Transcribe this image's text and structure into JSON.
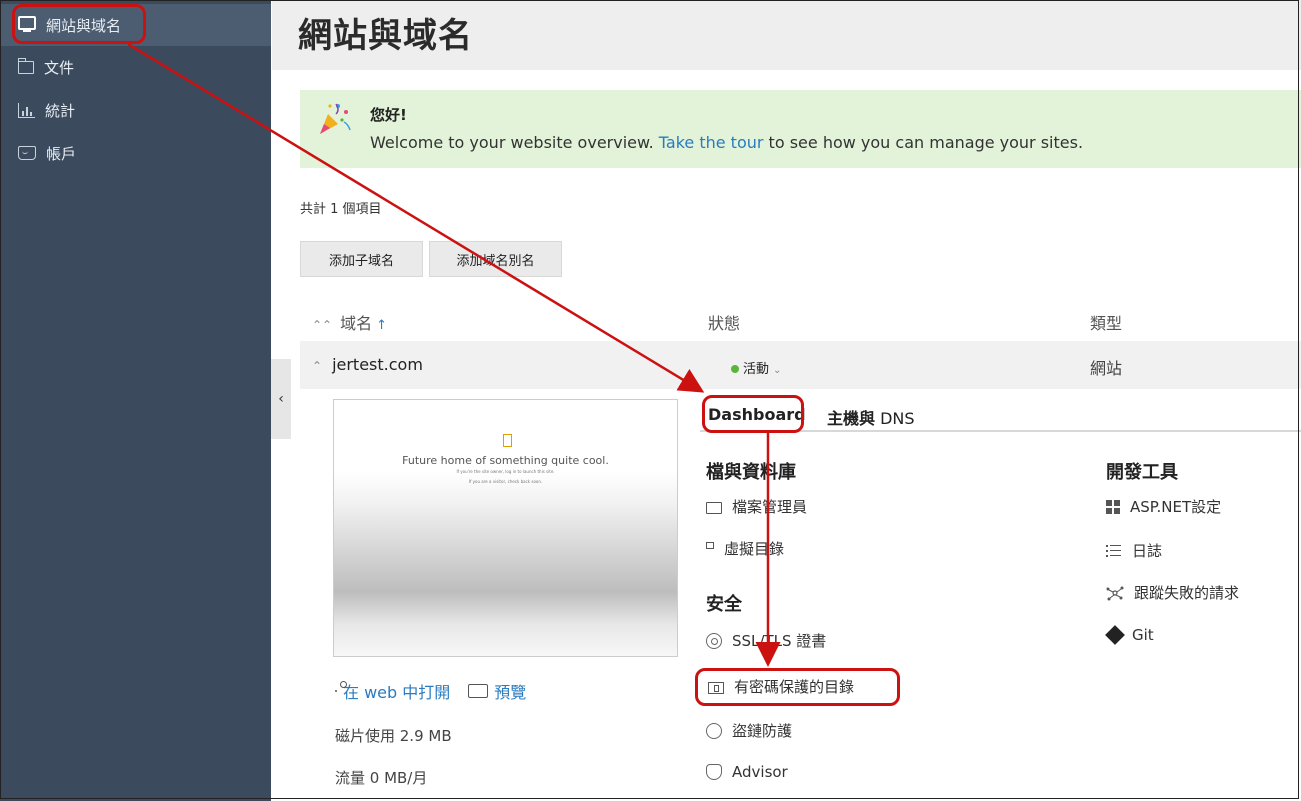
{
  "sidebar": {
    "items": [
      {
        "label": "網站與域名",
        "icon": "monitor-icon",
        "active": true
      },
      {
        "label": "文件",
        "icon": "folder-icon"
      },
      {
        "label": "統計",
        "icon": "chart-icon"
      },
      {
        "label": "帳戶",
        "icon": "account-icon"
      }
    ],
    "collapse_glyph": "‹"
  },
  "page": {
    "title": "網站與域名"
  },
  "welcome": {
    "greeting": "您好!",
    "text_before": "Welcome to your website overview. ",
    "link": "Take the tour",
    "text_after": " to see how you can manage your sites."
  },
  "list": {
    "total": "共計 1 個項目",
    "buttons": {
      "add_subdomain": "添加子域名",
      "add_alias": "添加域名別名"
    },
    "columns": {
      "domain": "域名",
      "status": "狀態",
      "type": "類型"
    },
    "sort_arrow": "↑",
    "row": {
      "domain": "jertest.com",
      "status": "活動",
      "type": "網站"
    }
  },
  "preview": {
    "headline": "Future home of something quite cool.",
    "sub1": "If you're the site owner, log in to launch this site.",
    "sub2": "If you are a visitor, check back soon."
  },
  "site": {
    "open_web": "在 web 中打開",
    "preview": "預覽",
    "disk_usage": "磁片使用 2.9 MB",
    "traffic": "流量 0 MB/月"
  },
  "tabs": {
    "dashboard": "Dashboard",
    "hosting_bold": "主機與",
    "hosting_rest": " DNS"
  },
  "sections": {
    "files_db": {
      "title": "檔與資料庫",
      "items": [
        {
          "label": "檔案管理員",
          "icon": "folder-icon"
        },
        {
          "label": "虛擬目錄",
          "icon": "virtual-directory-icon"
        }
      ]
    },
    "security": {
      "title": "安全",
      "items": [
        {
          "label": "SSL/TLS 證書",
          "icon": "certificate-icon"
        },
        {
          "label": "有密碼保護的目錄",
          "icon": "protected-directory-icon"
        },
        {
          "label": "盜鏈防護",
          "icon": "hotlink-protection-icon"
        },
        {
          "label": "Advisor",
          "icon": "advisor-icon"
        }
      ]
    },
    "dev_tools": {
      "title": "開發工具",
      "items": [
        {
          "label": "ASP.NET設定",
          "icon": "aspnet-grid-icon"
        },
        {
          "label": "日誌",
          "icon": "logs-list-icon"
        },
        {
          "label": "跟蹤失敗的請求",
          "icon": "failed-request-tracing-icon"
        },
        {
          "label": "Git",
          "icon": "git-icon"
        }
      ]
    }
  },
  "colors": {
    "sidebar_bg": "#3b4a5c",
    "accent_link": "#2a7bbf",
    "welcome_bg": "#e3f3d9",
    "status_active": "#5bb53b",
    "annotation_red": "#cc1111"
  }
}
